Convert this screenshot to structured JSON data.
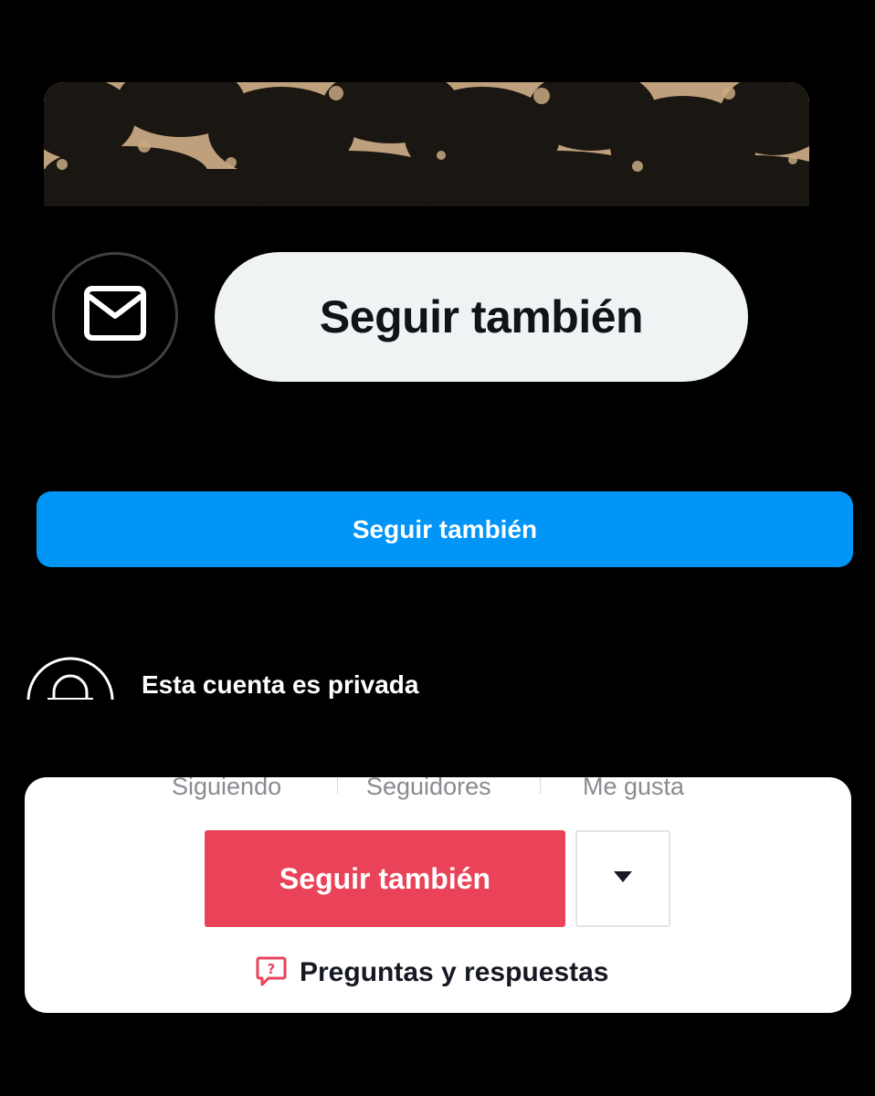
{
  "twitter": {
    "follow_label": "Seguir también",
    "mail_icon": "envelope-icon"
  },
  "instagram": {
    "follow_label": "Seguir también",
    "accent_color": "#0095f6",
    "private_text": "Esta cuenta es privada",
    "lock_icon": "lock-icon"
  },
  "tiktok": {
    "stats": [
      {
        "label": "Siguiendo"
      },
      {
        "label": "Seguidores"
      },
      {
        "label": "Me gusta"
      }
    ],
    "follow_label": "Seguir también",
    "accent_color": "#ea4359",
    "dropdown_icon": "caret-down-icon",
    "qa_label": "Preguntas y respuestas",
    "qa_icon": "question-bubble-icon"
  }
}
